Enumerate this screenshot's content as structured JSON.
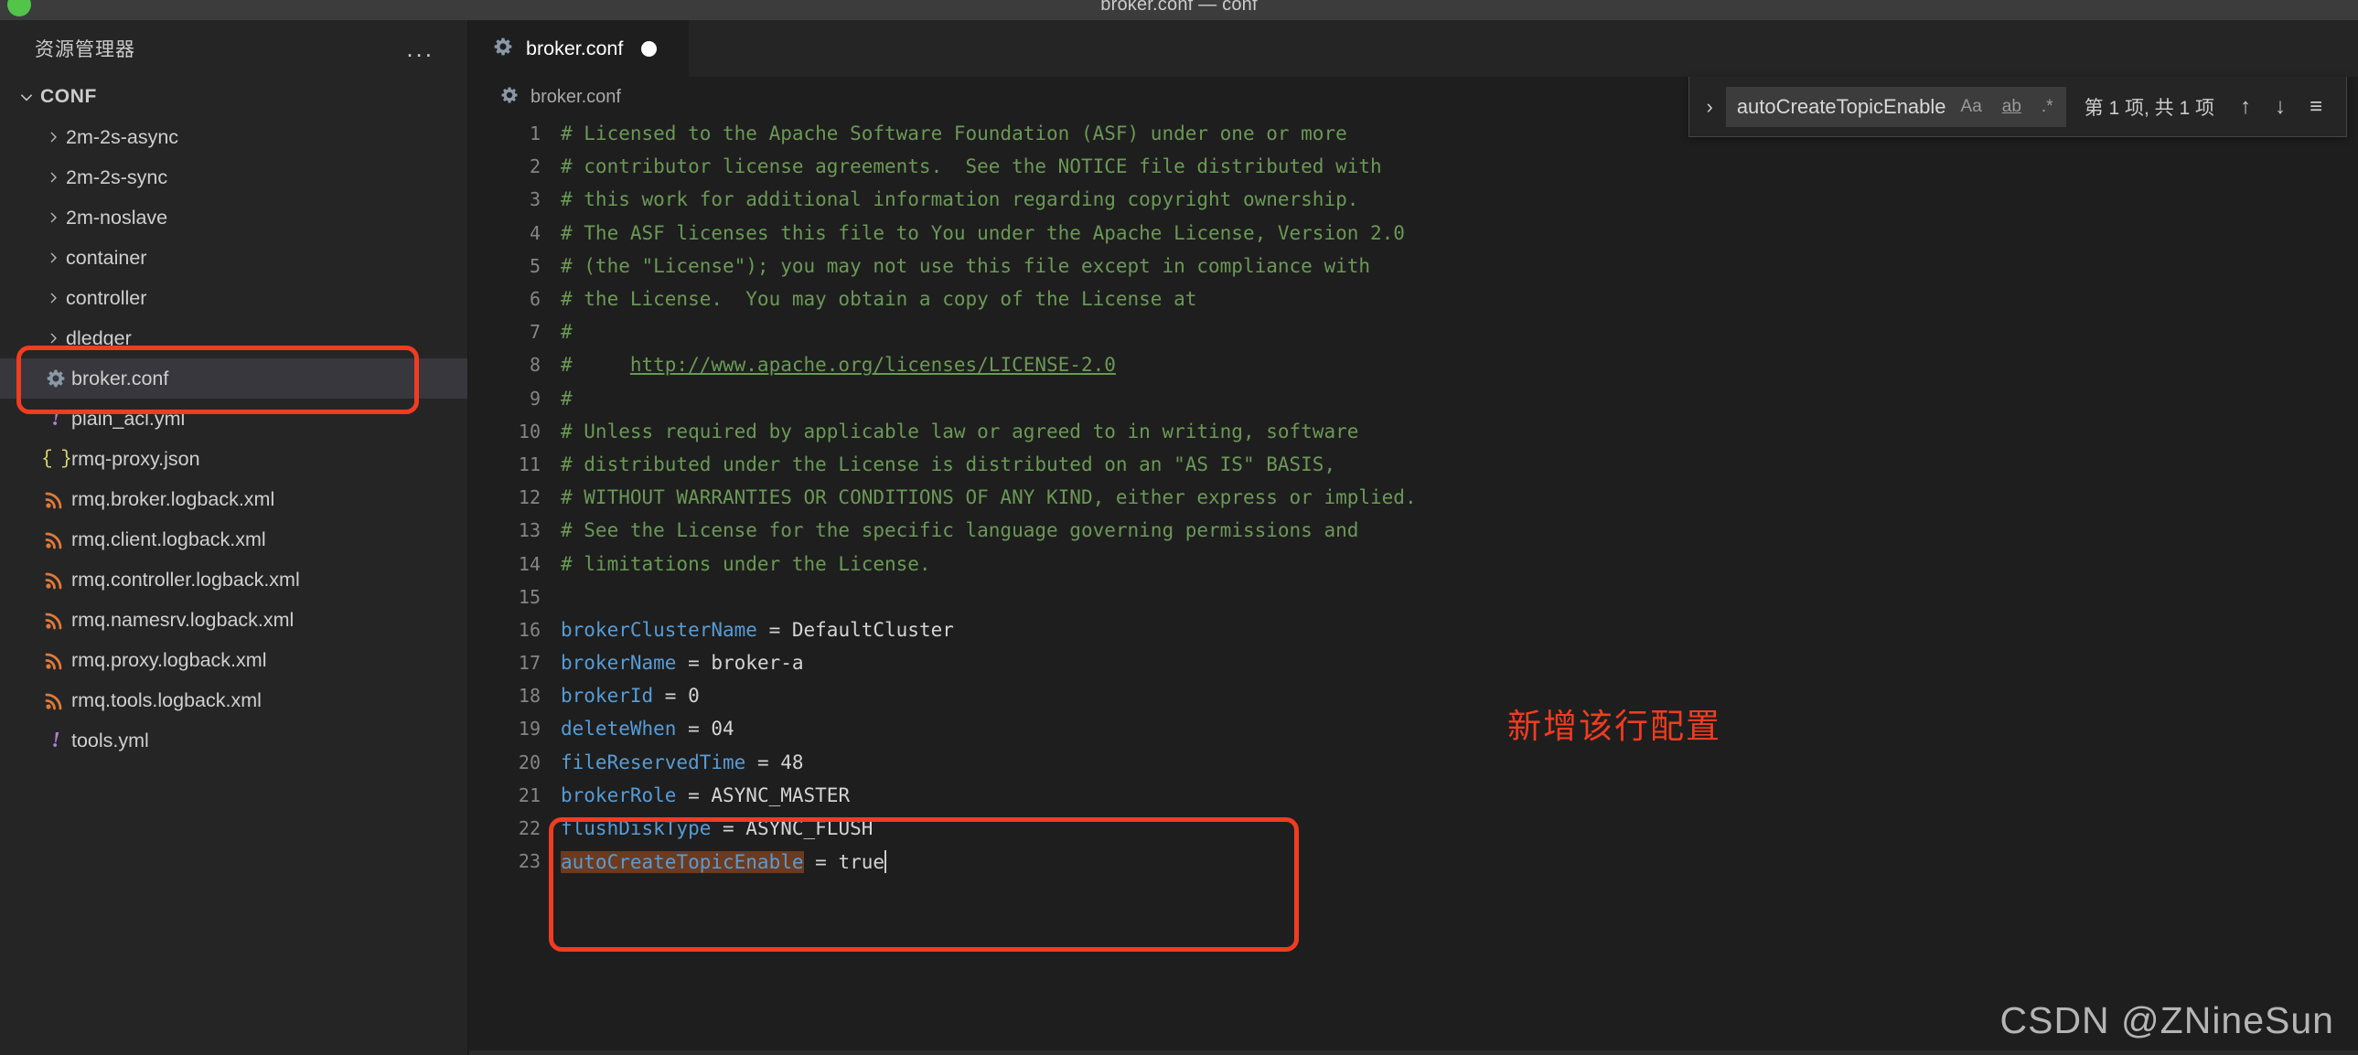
{
  "window": {
    "title": "broker.conf — conf",
    "traffic_light_color": "#52c44a"
  },
  "sidebar": {
    "header_title": "资源管理器",
    "more_actions": "...",
    "section": {
      "label": "CONF",
      "chevron": "chevron-down",
      "expanded": true
    },
    "items": [
      {
        "label": "2m-2s-async",
        "kind": "folder",
        "icon": "chevron-right-icon",
        "selected": false
      },
      {
        "label": "2m-2s-sync",
        "kind": "folder",
        "icon": "chevron-right-icon",
        "selected": false
      },
      {
        "label": "2m-noslave",
        "kind": "folder",
        "icon": "chevron-right-icon",
        "selected": false
      },
      {
        "label": "container",
        "kind": "folder",
        "icon": "chevron-right-icon",
        "selected": false
      },
      {
        "label": "controller",
        "kind": "folder",
        "icon": "chevron-right-icon",
        "selected": false
      },
      {
        "label": "dledger",
        "kind": "folder",
        "icon": "chevron-right-icon",
        "selected": false
      },
      {
        "label": "broker.conf",
        "kind": "file",
        "icon": "gear-icon",
        "selected": true
      },
      {
        "label": "plain_acl.yml",
        "kind": "file",
        "icon": "yaml-icon",
        "selected": false
      },
      {
        "label": "rmq-proxy.json",
        "kind": "file",
        "icon": "json-icon",
        "selected": false
      },
      {
        "label": "rmq.broker.logback.xml",
        "kind": "file",
        "icon": "xml-icon",
        "selected": false
      },
      {
        "label": "rmq.client.logback.xml",
        "kind": "file",
        "icon": "xml-icon",
        "selected": false
      },
      {
        "label": "rmq.controller.logback.xml",
        "kind": "file",
        "icon": "xml-icon",
        "selected": false
      },
      {
        "label": "rmq.namesrv.logback.xml",
        "kind": "file",
        "icon": "xml-icon",
        "selected": false
      },
      {
        "label": "rmq.proxy.logback.xml",
        "kind": "file",
        "icon": "xml-icon",
        "selected": false
      },
      {
        "label": "rmq.tools.logback.xml",
        "kind": "file",
        "icon": "xml-icon",
        "selected": false
      },
      {
        "label": "tools.yml",
        "kind": "file",
        "icon": "yaml-icon",
        "selected": false
      }
    ]
  },
  "editor": {
    "tab": {
      "label": "broker.conf",
      "icon": "gear-icon",
      "dirty": true
    },
    "breadcrumb": {
      "label": "broker.conf",
      "icon": "gear-icon"
    },
    "cursor_line": 23,
    "lines": [
      {
        "n": "1",
        "segments": [
          {
            "text": "# Licensed to the Apache Software Foundation (ASF) under one or more",
            "style": "comment"
          }
        ]
      },
      {
        "n": "2",
        "segments": [
          {
            "text": "# contributor license agreements.  See the NOTICE file distributed with",
            "style": "comment"
          }
        ]
      },
      {
        "n": "3",
        "segments": [
          {
            "text": "# this work for additional information regarding copyright ownership.",
            "style": "comment"
          }
        ]
      },
      {
        "n": "4",
        "segments": [
          {
            "text": "# The ASF licenses this file to You under the Apache License, Version 2.0",
            "style": "comment"
          }
        ]
      },
      {
        "n": "5",
        "segments": [
          {
            "text": "# (the \"License\"); you may not use this file except in compliance with",
            "style": "comment"
          }
        ]
      },
      {
        "n": "6",
        "segments": [
          {
            "text": "# the License.  You may obtain a copy of the License at",
            "style": "comment"
          }
        ]
      },
      {
        "n": "7",
        "segments": [
          {
            "text": "#",
            "style": "comment"
          }
        ]
      },
      {
        "n": "8",
        "segments": [
          {
            "text": "#     ",
            "style": "comment"
          },
          {
            "text": "http://www.apache.org/licenses/LICENSE-2.0",
            "style": "link"
          }
        ]
      },
      {
        "n": "9",
        "segments": [
          {
            "text": "#",
            "style": "comment"
          }
        ]
      },
      {
        "n": "10",
        "segments": [
          {
            "text": "# Unless required by applicable law or agreed to in writing, software",
            "style": "comment"
          }
        ]
      },
      {
        "n": "11",
        "segments": [
          {
            "text": "# distributed under the License is distributed on an \"AS IS\" BASIS,",
            "style": "comment"
          }
        ]
      },
      {
        "n": "12",
        "segments": [
          {
            "text": "# WITHOUT WARRANTIES OR CONDITIONS OF ANY KIND, either express or implied.",
            "style": "comment"
          }
        ]
      },
      {
        "n": "13",
        "segments": [
          {
            "text": "# See the License for the specific language governing permissions and",
            "style": "comment"
          }
        ]
      },
      {
        "n": "14",
        "segments": [
          {
            "text": "# limitations under the License.",
            "style": "comment"
          }
        ]
      },
      {
        "n": "15",
        "segments": [
          {
            "text": "",
            "style": "plain"
          }
        ]
      },
      {
        "n": "16",
        "segments": [
          {
            "text": "brokerClusterName",
            "style": "key"
          },
          {
            "text": " = DefaultCluster",
            "style": "plain"
          }
        ]
      },
      {
        "n": "17",
        "segments": [
          {
            "text": "brokerName",
            "style": "key"
          },
          {
            "text": " = broker-a",
            "style": "plain"
          }
        ]
      },
      {
        "n": "18",
        "segments": [
          {
            "text": "brokerId",
            "style": "key"
          },
          {
            "text": " = 0",
            "style": "plain"
          }
        ]
      },
      {
        "n": "19",
        "segments": [
          {
            "text": "deleteWhen",
            "style": "key"
          },
          {
            "text": " = 04",
            "style": "plain"
          }
        ]
      },
      {
        "n": "20",
        "segments": [
          {
            "text": "fileReservedTime",
            "style": "key"
          },
          {
            "text": " = 48",
            "style": "plain"
          }
        ]
      },
      {
        "n": "21",
        "segments": [
          {
            "text": "brokerRole",
            "style": "key"
          },
          {
            "text": " = ASYNC_MASTER",
            "style": "plain"
          }
        ]
      },
      {
        "n": "22",
        "segments": [
          {
            "text": "flushDiskType",
            "style": "key"
          },
          {
            "text": " = ASYNC_FLUSH",
            "style": "plain"
          }
        ]
      },
      {
        "n": "23",
        "segments": [
          {
            "text": "autoCreateTopicEnable",
            "style": "key-highlight"
          },
          {
            "text": " = true",
            "style": "plain"
          },
          {
            "text": "",
            "style": "caret"
          }
        ]
      }
    ]
  },
  "find_widget": {
    "toggle_icon": "chevron-right-icon",
    "query": "autoCreateTopicEnable",
    "match_case_label": "Aa",
    "whole_word_label": "ab",
    "regex_label": ".*",
    "result_count": "第 1 项, 共 1 项",
    "prev_icon": "arrow-up-icon",
    "next_icon": "arrow-down-icon",
    "selection_icon": "find-in-selection-icon"
  },
  "annotations": {
    "note_text": "新增该行配置",
    "note_color": "#f03c20",
    "box_color": "#f03c20",
    "watermark": "CSDN @ZNineSun"
  }
}
